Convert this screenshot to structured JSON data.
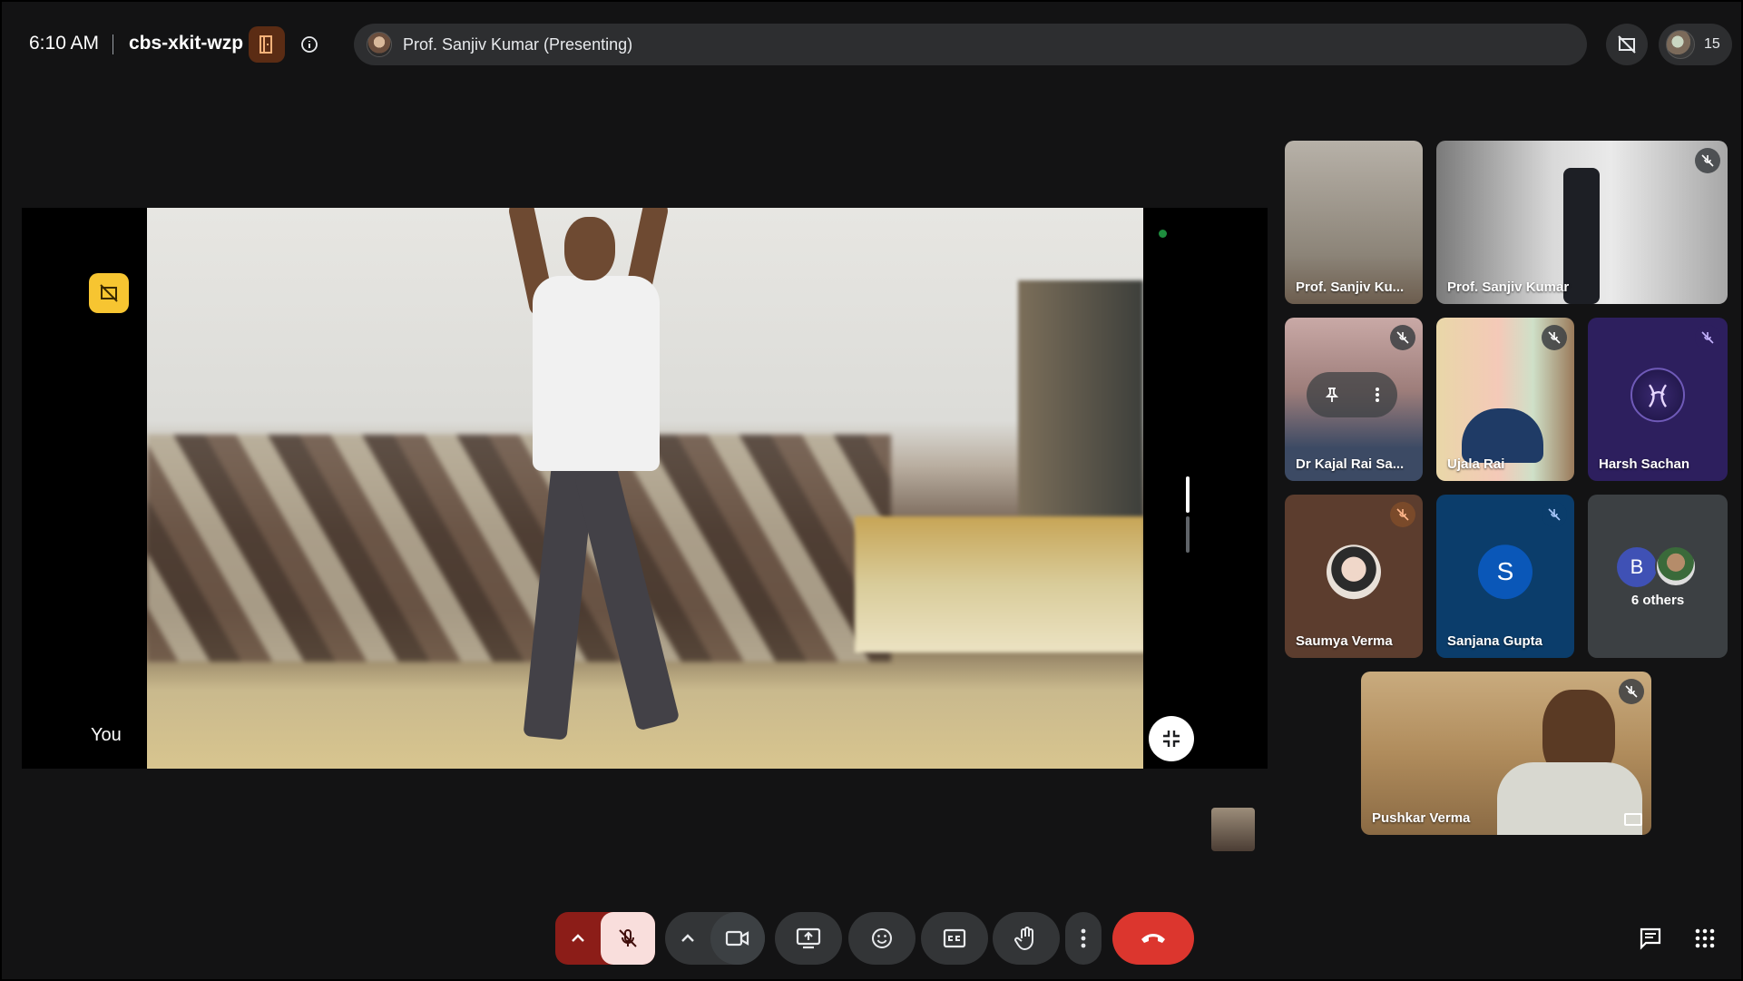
{
  "header": {
    "time": "6:10 AM",
    "meeting_code": "cbs-xkit-wzp",
    "presenter_label": "Prof. Sanjiv Kumar (Presenting)",
    "participant_count": "15"
  },
  "main": {
    "self_label": "You"
  },
  "tiles": [
    {
      "name": "Prof. Sanjiv Ku...",
      "muted": false
    },
    {
      "name": "Prof. Sanjiv Kumar",
      "muted": true
    },
    {
      "name": "Dr Kajal Rai Sa...",
      "muted": true
    },
    {
      "name": "Ujala Rai",
      "muted": true
    },
    {
      "name": "Harsh Sachan",
      "muted": true
    },
    {
      "name": "Saumya Verma",
      "muted": true
    },
    {
      "name": "Sanjana Gupta",
      "muted": true,
      "initial": "S"
    },
    {
      "name": "6 others",
      "initial": "B"
    },
    {
      "name": "Pushkar Verma",
      "muted": true
    }
  ],
  "colors": {
    "background": "#131314",
    "control": "#333537",
    "end_call": "#dc362e",
    "mic_muted_bg": "#8c1d18",
    "mic_muted_fg": "#f9dedc",
    "nosignal_badge": "#f7c531",
    "harsh_tile": "#2d1f5e",
    "saumya_tile": "#5c3d2e",
    "sanjana_tile": "#0b3d6b"
  },
  "icons": [
    "door-icon",
    "info-icon",
    "no-signal-icon",
    "minimize-icon",
    "pin-icon",
    "more-vert-icon",
    "mic-off-icon",
    "chevron-up-icon",
    "videocam-icon",
    "present-icon",
    "emoji-icon",
    "captions-icon",
    "hand-icon",
    "call-end-icon",
    "chat-icon",
    "apps-icon"
  ]
}
